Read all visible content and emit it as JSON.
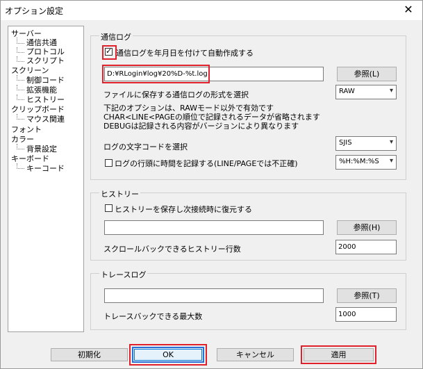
{
  "window": {
    "title": "オプション設定",
    "close_glyph": "✕"
  },
  "tree": {
    "items": [
      {
        "label": "サーバー",
        "level": 0
      },
      {
        "label": "通信共通",
        "level": 1
      },
      {
        "label": "プロトコル",
        "level": 1
      },
      {
        "label": "スクリプト",
        "level": 1
      },
      {
        "label": "スクリーン",
        "level": 0
      },
      {
        "label": "制御コード",
        "level": 1
      },
      {
        "label": "拡張機能",
        "level": 1
      },
      {
        "label": "ヒストリー",
        "level": 1
      },
      {
        "label": "クリップボード",
        "level": 0
      },
      {
        "label": "マウス関連",
        "level": 1
      },
      {
        "label": "フォント",
        "level": 0
      },
      {
        "label": "カラー",
        "level": 0
      },
      {
        "label": "背景設定",
        "level": 1
      },
      {
        "label": "キーボード",
        "level": 0
      },
      {
        "label": "キーコード",
        "level": 1
      }
    ]
  },
  "comm_log": {
    "group_label": "通信ログ",
    "auto_create_label": "通信ログを年月日を付けて自動作成する",
    "auto_create_checked": true,
    "path_value": "D:¥RLogin¥log¥20%D-%t.log",
    "browse_label": "参照(L)",
    "format_label": "ファイルに保存する通信ログの形式を選択",
    "format_value": "RAW",
    "note_lines": [
      "下記のオプションは、RAWモード以外で有効です",
      "CHAR<LINE<PAGEの順位で記録されるデータが省略されます",
      "DEBUGは記録される内容がバージョンにより異なります"
    ],
    "charset_label": "ログの文字コードを選択",
    "charset_value": "SJIS",
    "timestamp_label": "ログの行頭に時間を記録する(LINE/PAGEでは不正確)",
    "timestamp_checked": false,
    "time_format_value": "%H:%M:%S"
  },
  "history": {
    "group_label": "ヒストリー",
    "save_label": "ヒストリーを保存し次接続時に復元する",
    "save_checked": false,
    "path_value": "",
    "browse_label": "参照(H)",
    "scrollback_label": "スクロールバックできるヒストリー行数",
    "scrollback_value": "2000"
  },
  "trace": {
    "group_label": "トレースログ",
    "path_value": "",
    "browse_label": "参照(T)",
    "max_label": "トレースバックできる最大数",
    "max_value": "1000"
  },
  "buttons": {
    "init_label": "初期化",
    "ok_label": "OK",
    "cancel_label": "キャンセル",
    "apply_label": "適用"
  },
  "colors": {
    "highlight_red": "#e0202a",
    "focus_blue": "#2a6fd6"
  }
}
